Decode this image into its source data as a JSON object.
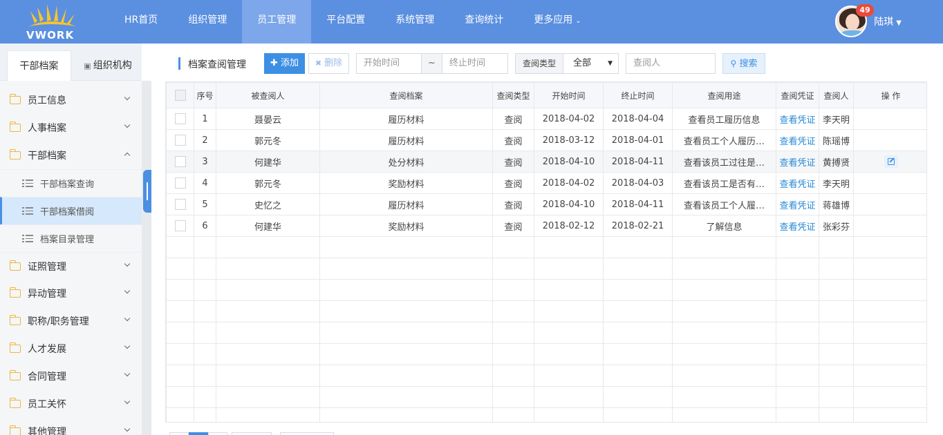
{
  "logo": {
    "text": "VWORK"
  },
  "nav": {
    "items": [
      {
        "label": "HR首页"
      },
      {
        "label": "组织管理"
      },
      {
        "label": "员工管理"
      },
      {
        "label": "平台配置"
      },
      {
        "label": "系统管理"
      },
      {
        "label": "查询统计"
      },
      {
        "label": "更多应用"
      }
    ],
    "active_index": 2
  },
  "user": {
    "name": "陆琪",
    "badge_count": "49"
  },
  "sidebar": {
    "tabs": [
      {
        "label": "干部档案"
      },
      {
        "label": "组织机构"
      }
    ],
    "menu": [
      {
        "label": "员工信息"
      },
      {
        "label": "人事档案"
      },
      {
        "label": "干部档案"
      },
      {
        "label": "证照管理"
      },
      {
        "label": "异动管理"
      },
      {
        "label": "职称/职务管理"
      },
      {
        "label": "人才发展"
      },
      {
        "label": "合同管理"
      },
      {
        "label": "员工关怀"
      },
      {
        "label": "其他管理"
      }
    ],
    "submenu": [
      {
        "label": "干部档案查询"
      },
      {
        "label": "干部档案借阅"
      },
      {
        "label": "档案目录管理"
      }
    ]
  },
  "toolbar": {
    "title": "档案查阅管理",
    "add_label": "添加",
    "delete_label": "删除",
    "start_placeholder": "开始时间",
    "tilde": "~",
    "end_placeholder": "终止时间",
    "type_label": "查阅类型",
    "type_value": "全部",
    "query_placeholder": "查阅人",
    "search_label": "搜索"
  },
  "table": {
    "headers": [
      "序号",
      "被查阅人",
      "查阅档案",
      "查阅类型",
      "开始时间",
      "终止时间",
      "查阅用途",
      "查阅凭证",
      "查阅人",
      "操 作"
    ],
    "rows": [
      [
        "1",
        "聂晏云",
        "履历材料",
        "查阅",
        "2018-04-02",
        "2018-04-04",
        "查看员工履历信息",
        "查看凭证",
        "李天明"
      ],
      [
        "2",
        "郭元冬",
        "履历材料",
        "查阅",
        "2018-03-12",
        "2018-04-01",
        "查看员工个人履历…",
        "查看凭证",
        "陈瑶博"
      ],
      [
        "3",
        "何建华",
        "处分材料",
        "查阅",
        "2018-04-10",
        "2018-04-11",
        "查看该员工过往是…",
        "查看凭证",
        "黄搏贤"
      ],
      [
        "4",
        "郭元冬",
        "奖励材料",
        "查阅",
        "2018-04-02",
        "2018-04-03",
        "查看该员工是否有…",
        "查看凭证",
        "李天明"
      ],
      [
        "5",
        "史忆之",
        "履历材料",
        "查阅",
        "2018-04-10",
        "2018-04-11",
        "查看该员工个人履…",
        "查看凭证",
        "蒋雄博"
      ],
      [
        "6",
        "何建华",
        "奖励材料",
        "查阅",
        "2018-02-12",
        "2018-02-21",
        "了解信息",
        "查看凭证",
        "张彩芬"
      ]
    ]
  },
  "colors": {
    "topbar": "#5b8fe0",
    "accent": "#3d8fe4",
    "link": "#2a8ad6",
    "badge": "#e94b3c",
    "folder": "#f0b63a"
  }
}
